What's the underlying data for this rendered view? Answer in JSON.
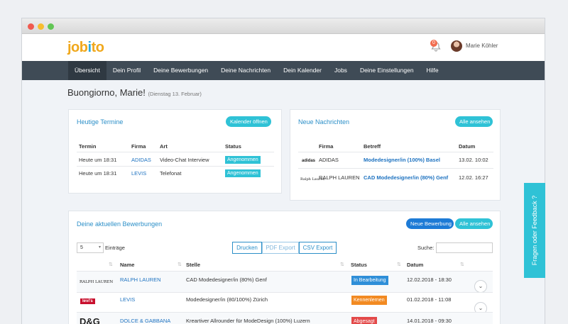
{
  "header": {
    "logo_prefix": "job",
    "logo_o": "i",
    "logo_suffix": "to",
    "notification_count": "0",
    "user_name": "Marie Köhler"
  },
  "nav": [
    "Übersicht",
    "Dein Profil",
    "Deine Bewerbungen",
    "Deine Nachrichten",
    "Dein Kalender",
    "Jobs",
    "Deine Einstellungen",
    "Hilfe"
  ],
  "greeting": {
    "text": "Buongiorno, Marie!",
    "date": "(Dienstag 13. Februar)"
  },
  "termine": {
    "title": "Heutige Termine",
    "button": "Kalender öffnen",
    "headers": [
      "Termin",
      "Firma",
      "Art",
      "Status"
    ],
    "rows": [
      {
        "termin": "Heute um 18:31",
        "firma": "ADIDAS",
        "art": "Video-Chat Interview",
        "status": "Angenommen"
      },
      {
        "termin": "Heute um 18:31",
        "firma": "LEVIS",
        "art": "Telefonat",
        "status": "Angenommen"
      }
    ]
  },
  "nachrichten": {
    "title": "Neue Nachrichten",
    "button": "Alle ansehen",
    "headers": [
      "Firma",
      "Betreff",
      "Datum"
    ],
    "rows": [
      {
        "logo": "adidas",
        "firma": "ADIDAS",
        "betreff": "Modedesigner/in (100%) Basel",
        "datum": "13.02. 10:02"
      },
      {
        "logo": "Ralph Lauren",
        "firma": "RALPH LAUREN",
        "betreff": "CAD Modedesigner/in (80%) Genf",
        "datum": "12.02. 16:27"
      }
    ]
  },
  "bewerbungen": {
    "title": "Deine aktuellen Bewerbungen",
    "new_button": "Neue Bewerbung",
    "all_button": "Alle ansehen",
    "entries_value": "5",
    "entries_label": "Einträge",
    "export": [
      "Drucken",
      "PDF Export",
      "CSV Export"
    ],
    "search_label": "Suche:",
    "headers": [
      "Name",
      "Stelle",
      "Status",
      "Datum"
    ],
    "rows": [
      {
        "logo": "RALPH LAUREN",
        "name": "RALPH LAUREN",
        "stelle": "CAD Modedesigner/in (80%) Genf",
        "status": "In Bearbeitung",
        "datum": "12.02.2018 - 18:30"
      },
      {
        "logo": "levi's",
        "name": "LEVIS",
        "stelle": "Modedesigner/in (80/100%) Zürich",
        "status": "Kennenlernen",
        "datum": "01.02.2018 - 11:08"
      },
      {
        "logo": "D&G",
        "name": "DOLCE & GABBANA",
        "stelle": "Kreartiver Allrounder für ModeDesign (100%) Luzern",
        "status": "Abgesagt",
        "datum": "14.01.2018 - 09:30"
      }
    ]
  },
  "feedback": "Fragen oder Feedback ?",
  "colors": {
    "accent": "#2fc2d6",
    "nav": "#3f4b56",
    "logo_orange": "#f0a81c",
    "logo_blue": "#27aae0"
  }
}
